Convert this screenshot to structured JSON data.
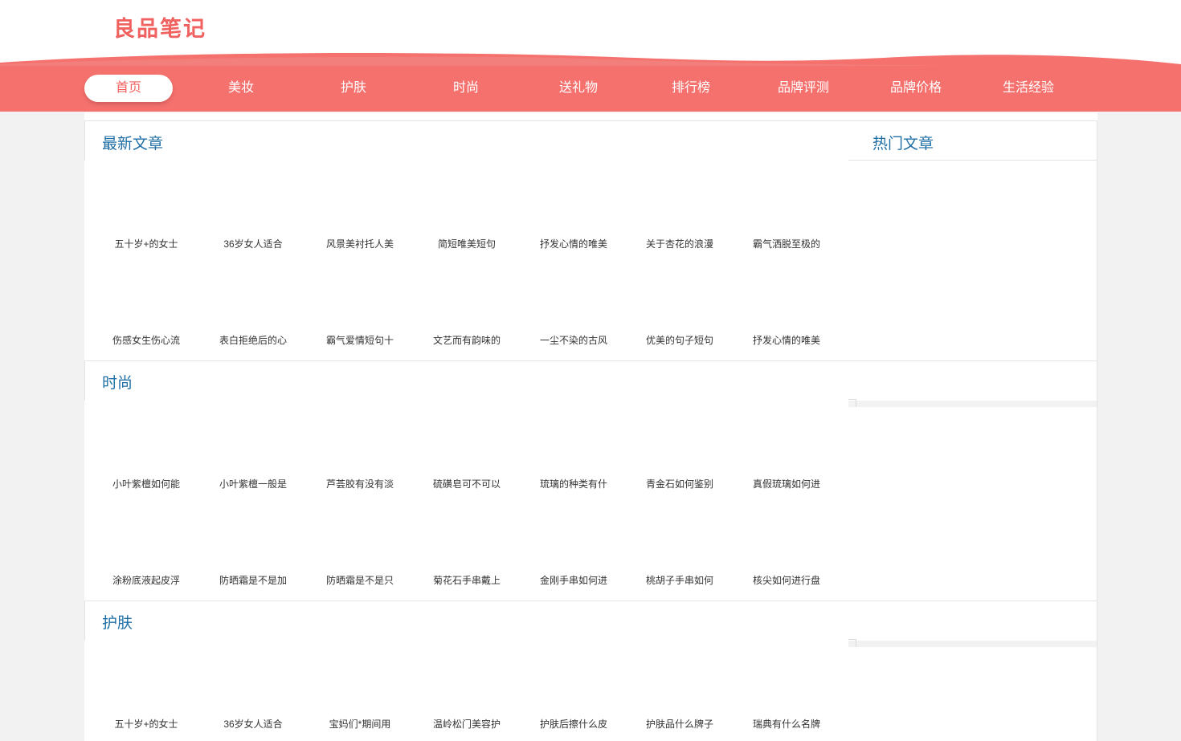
{
  "logo": "良品笔记",
  "nav": [
    "首页",
    "美妆",
    "护肤",
    "时尚",
    "送礼物",
    "排行榜",
    "品牌评测",
    "品牌价格",
    "生活经验"
  ],
  "sidebar": {
    "title": "热门文章"
  },
  "sections": [
    {
      "title": "最新文章",
      "rows": [
        [
          "五十岁+的女士",
          "36岁女人适合",
          "风景美衬托人美",
          "简短唯美短句",
          "抒发心情的唯美",
          "关于杏花的浪漫",
          "霸气洒脱至极的"
        ],
        [
          "伤感女生伤心流",
          "表白拒绝后的心",
          "霸气爱情短句十",
          "文艺而有韵味的",
          "一尘不染的古风",
          "优美的句子短句",
          "抒发心情的唯美"
        ]
      ]
    },
    {
      "title": "时尚",
      "rows": [
        [
          "小叶紫檀如何能",
          "小叶紫檀一般是",
          "芦荟胶有没有淡",
          "硫磺皂可不可以",
          "琉璃的种类有什",
          "青金石如何鉴别",
          "真假琉璃如何进"
        ],
        [
          "涂粉底液起皮浮",
          "防晒霜是不是加",
          "防晒霜是不是只",
          "菊花石手串戴上",
          "金刚手串如何进",
          "桃胡子手串如何",
          "核尖如何进行盘"
        ]
      ]
    },
    {
      "title": "护肤",
      "rows": [
        [
          "五十岁+的女士",
          "36岁女人适合",
          "宝妈们*期间用",
          "温岭松门美容护",
          "护肤后擦什么皮",
          "护肤品什么牌子",
          "瑞典有什么名牌"
        ]
      ]
    }
  ]
}
